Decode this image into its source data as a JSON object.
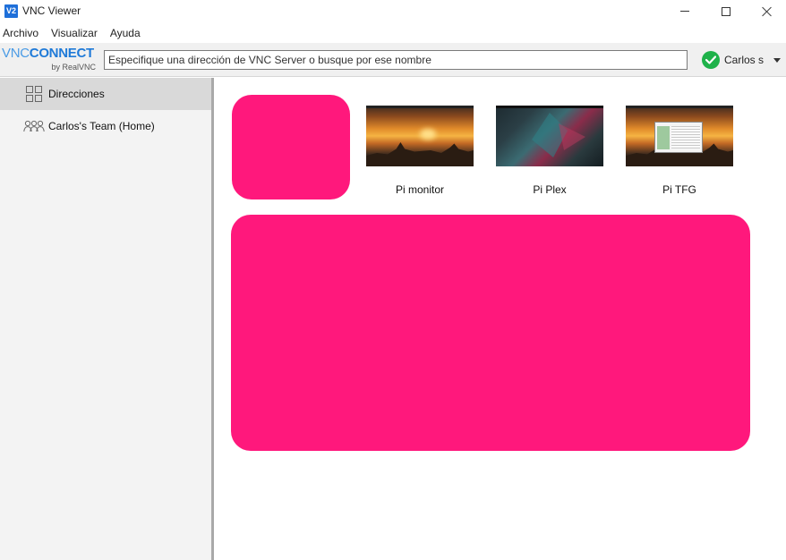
{
  "window": {
    "title": "VNC Viewer",
    "icon_text": "V2"
  },
  "menu": {
    "items": [
      {
        "label": "Archivo"
      },
      {
        "label": "Visualizar"
      },
      {
        "label": "Ayuda"
      }
    ]
  },
  "toolbar": {
    "logo_brand": "CONNECT",
    "logo_prefix": "VNC",
    "logo_sub": "by RealVNC",
    "address_placeholder": "Especifique una dirección de VNC Server o busque por ese nombre",
    "address_value": "",
    "user_name": "Carlos s",
    "status_color": "#1fb24a"
  },
  "sidebar": {
    "items": [
      {
        "label": "Direcciones",
        "icon": "grid-icon",
        "active": true
      },
      {
        "label": "Carlos's Team (Home)",
        "icon": "team-icon",
        "active": false
      }
    ]
  },
  "main": {
    "computers": [
      {
        "label": "Pi monitor",
        "thumbnail": "sunset-desktop"
      },
      {
        "label": "Pi Plex",
        "thumbnail": "polygon-desktop"
      },
      {
        "label": "Pi TFG",
        "thumbnail": "sunset-desktop-with-window"
      }
    ],
    "redaction_color": "#ff187c"
  }
}
